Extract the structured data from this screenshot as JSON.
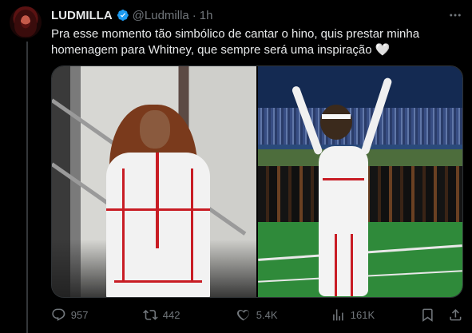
{
  "tweet": {
    "author_name": "LUDMILLA",
    "handle": "@Ludmilla",
    "separator": "·",
    "time": "1h",
    "text": "Pra esse momento tão simbólico de cantar o hino, quis prestar minha homenagem para Whitney, que sempre será uma inspiração 🤍"
  },
  "media": {
    "photos": [
      "photo-ludmilla-white-red-tracksuit-stairs",
      "photo-whitney-houston-anthem-stadium"
    ]
  },
  "actions": {
    "replies": "957",
    "retweets": "442",
    "likes": "5.4K",
    "views": "161K"
  },
  "icons": {
    "verified": "verified-badge-icon",
    "more": "more-icon",
    "reply": "reply-icon",
    "retweet": "retweet-icon",
    "like": "heart-icon",
    "views": "views-icon",
    "bookmark": "bookmark-icon",
    "share": "share-icon"
  },
  "colors": {
    "background": "#000000",
    "text": "#e7e9ea",
    "secondary": "#71767b",
    "verified": "#1d9bf0",
    "border": "#2f3336"
  }
}
